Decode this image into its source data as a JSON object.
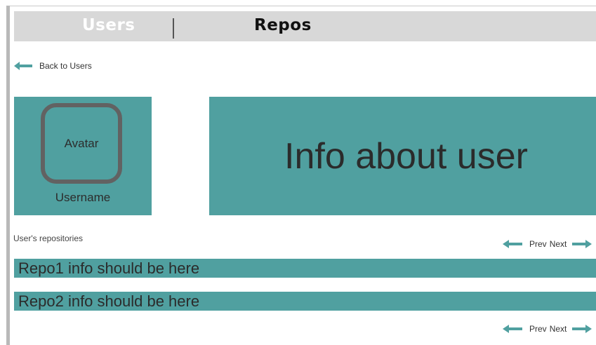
{
  "colors": {
    "accent": "#50a0a0",
    "navbar_bg": "#d8d8d8"
  },
  "nav": {
    "users_label": "Users",
    "repos_label": "Repos"
  },
  "back_link": {
    "label": "Back to Users",
    "icon": "arrow-left-icon"
  },
  "user": {
    "avatar_label": "Avatar",
    "username": "Username"
  },
  "info_panel": {
    "text": "Info about user"
  },
  "repos": {
    "title": "User's repositories",
    "items": [
      "Repo1 info should be here",
      "Repo2 info should be here"
    ]
  },
  "pager": {
    "prev_label": "Prev",
    "next_label": "Next"
  }
}
